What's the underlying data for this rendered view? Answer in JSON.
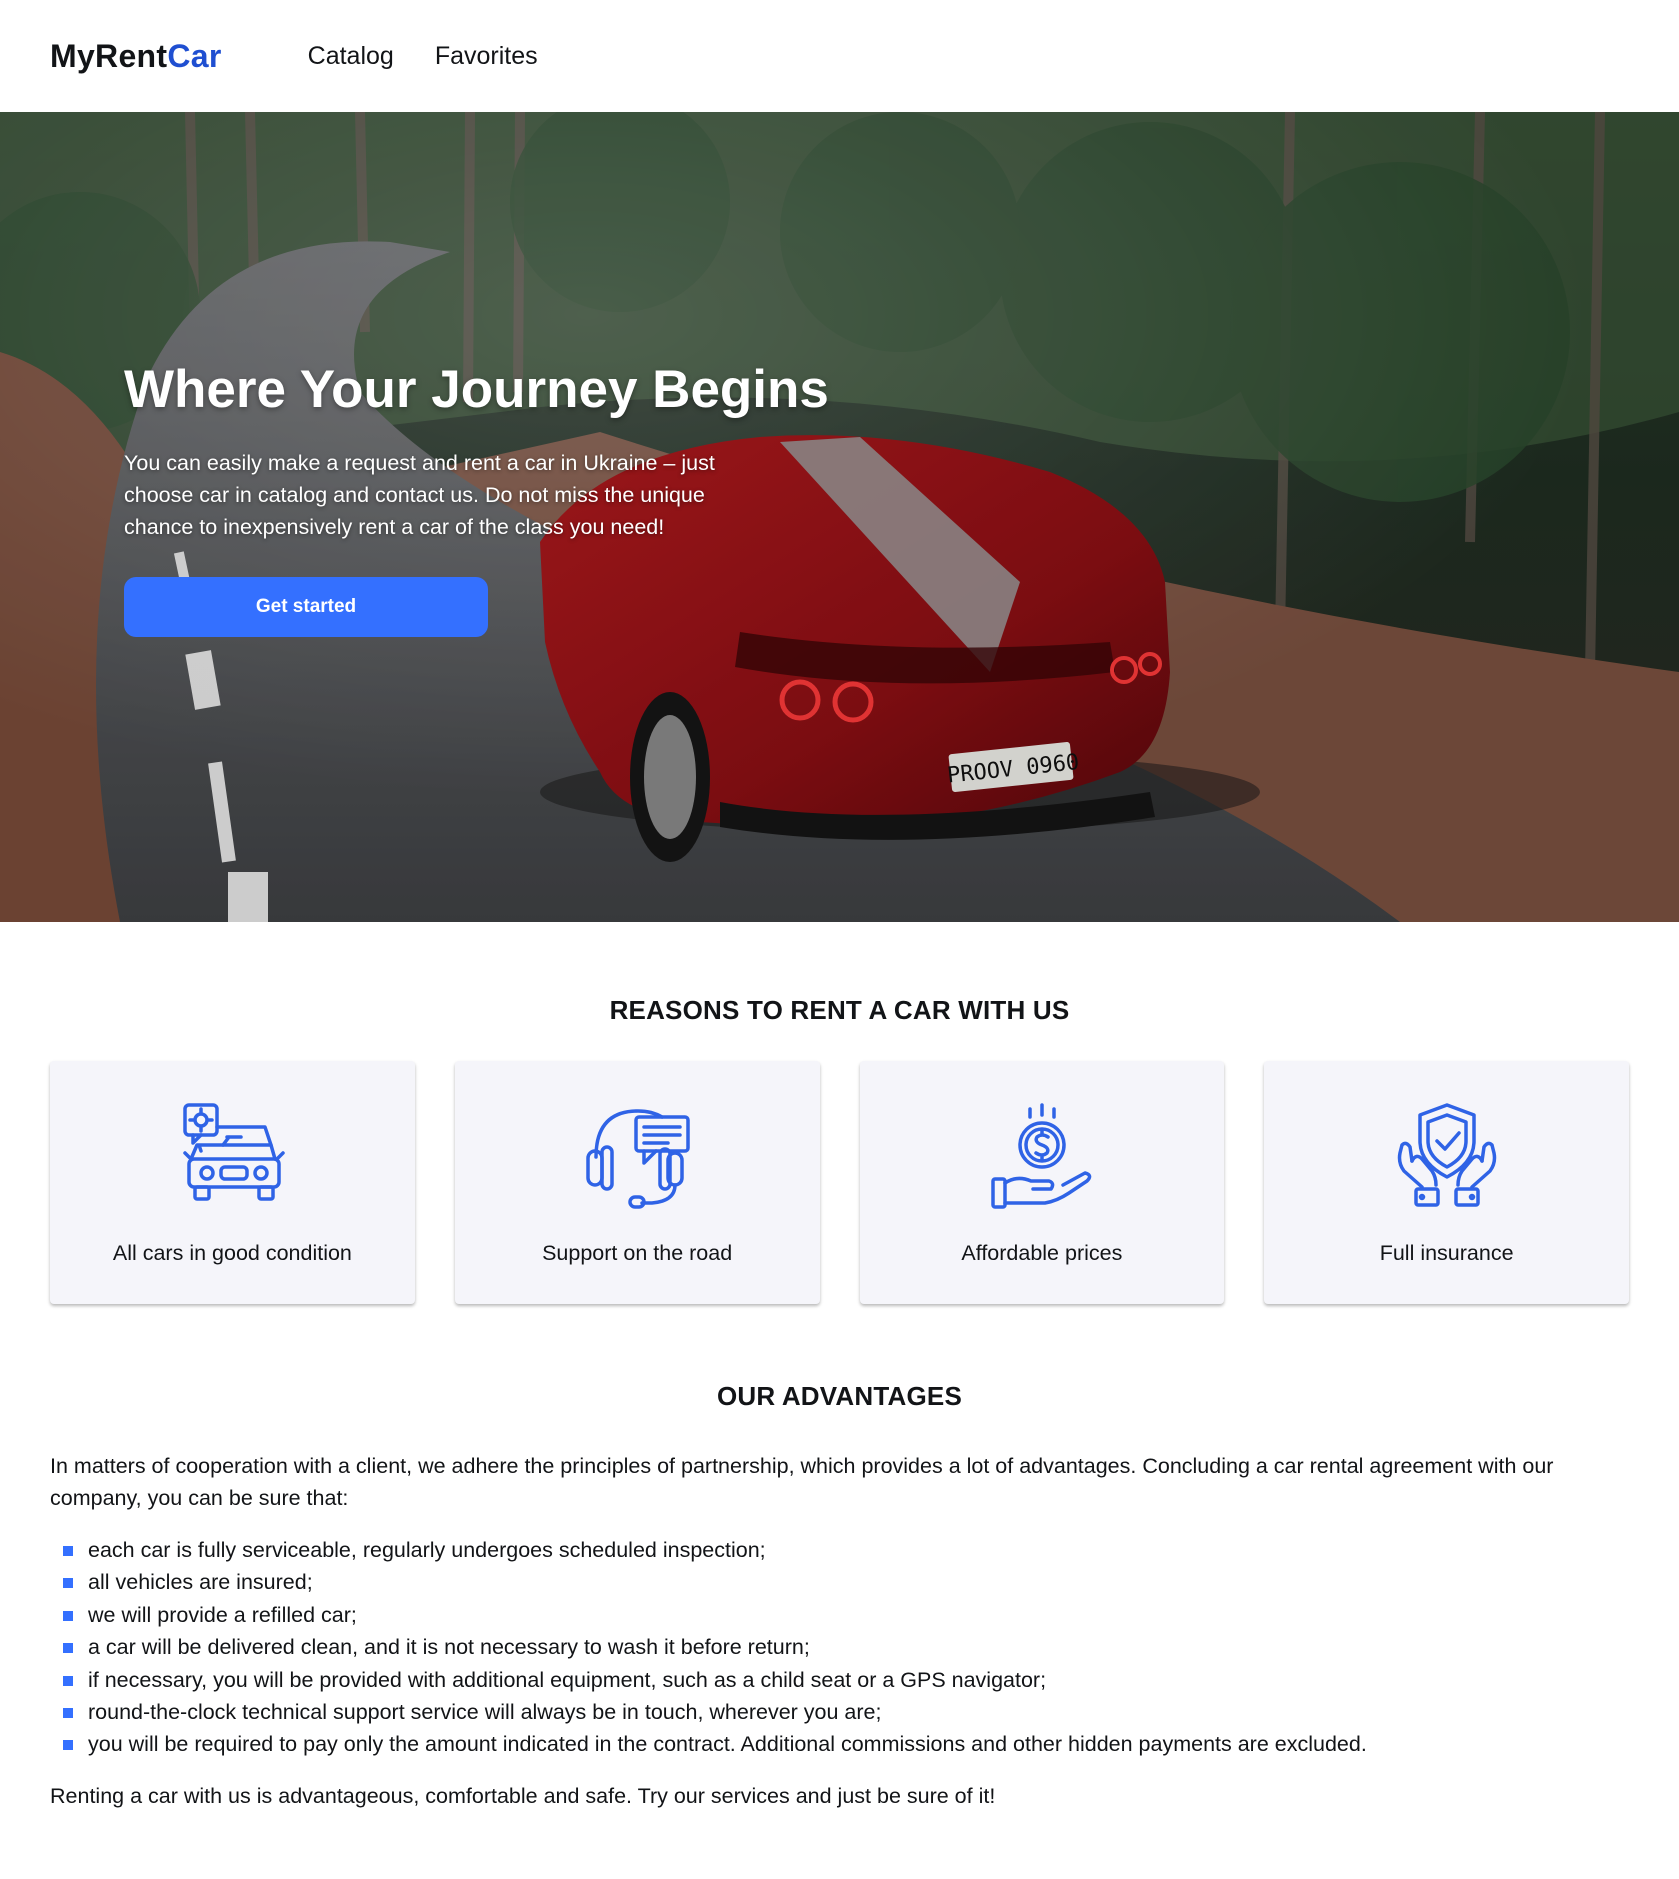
{
  "header": {
    "logo_main": "MyRent",
    "logo_accent": "Car",
    "nav": [
      "Catalog",
      "Favorites"
    ]
  },
  "hero": {
    "title": "Where Your Journey Begins",
    "text": "You can easily make a request and rent a car in Ukraine – just choose car in catalog and contact us. Do not miss the unique chance to inexpensively rent a car of the class you need!",
    "button": "Get started",
    "plate": "PROOV 0960"
  },
  "reasons": {
    "title": "REASONS TO RENT A CAR WITH US",
    "cards": [
      {
        "icon": "car-service-icon",
        "label": "All cars in good condition"
      },
      {
        "icon": "headset-support-icon",
        "label": "Support on the road"
      },
      {
        "icon": "dollar-hand-icon",
        "label": "Affordable prices"
      },
      {
        "icon": "shield-hands-icon",
        "label": "Full insurance"
      }
    ]
  },
  "advantages": {
    "title": "OUR ADVANTAGES",
    "intro": "In matters of cooperation with a client, we adhere the principles of partnership, which provides a lot of advantages. Concluding a car rental agreement with our company, you can be sure that:",
    "items": [
      "each car is fully serviceable, regularly undergoes scheduled inspection;",
      "all vehicles are insured;",
      "we will provide a refilled car;",
      "a car will be delivered clean, and it is not necessary to wash it before return;",
      "if necessary, you will be provided with additional equipment, such as a child seat or a GPS navigator;",
      "round-the-clock technical support service will always be in touch, wherever you are;",
      "you will be required to pay only the amount indicated in the contract. Additional commissions and other hidden payments are excluded."
    ],
    "outro": "Renting a car with us is advantageous, comfortable and safe. Try our services and just be sure of it!"
  },
  "colors": {
    "accent": "#3470ff",
    "logo_accent": "#1f4fd1",
    "text": "#121417",
    "card_bg": "#f5f5fa"
  }
}
